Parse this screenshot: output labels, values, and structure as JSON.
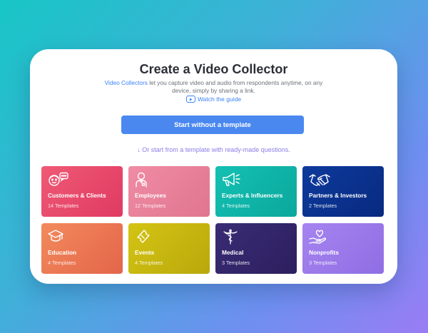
{
  "header": {
    "title": "Create a Video Collector",
    "desc_link": "Video Collectors",
    "desc_text": " let you capture video and audio from respondents anytime, on any device, simply by sharing a link.",
    "guide_label": "Watch the guide"
  },
  "actions": {
    "start_label": "Start without a template",
    "or_label": "↓ Or start from a template with ready-made questions."
  },
  "categories": [
    {
      "name": "Customers & Clients",
      "count": "14 Templates",
      "icon": "customers-chat-icon",
      "color": "#e8496b"
    },
    {
      "name": "Employees",
      "count": "12 Templates",
      "icon": "employee-badge-icon",
      "color": "#ec8199"
    },
    {
      "name": "Experts & Influencers",
      "count": "4 Templates",
      "icon": "megaphone-icon",
      "color": "#10b5a8"
    },
    {
      "name": "Partners & Investors",
      "count": "2 Templates",
      "icon": "handshake-icon",
      "color": "#0a318e"
    },
    {
      "name": "Education",
      "count": "4 Templates",
      "icon": "graduation-cap-icon",
      "color": "#ec7853"
    },
    {
      "name": "Events",
      "count": "4 Templates",
      "icon": "ticket-icon",
      "color": "#c8b70f"
    },
    {
      "name": "Medical",
      "count": "3 Templates",
      "icon": "caduceus-icon",
      "color": "#33266a"
    },
    {
      "name": "Nonprofits",
      "count": "3 Templates",
      "icon": "heart-hand-icon",
      "color": "#9a79ea"
    }
  ]
}
